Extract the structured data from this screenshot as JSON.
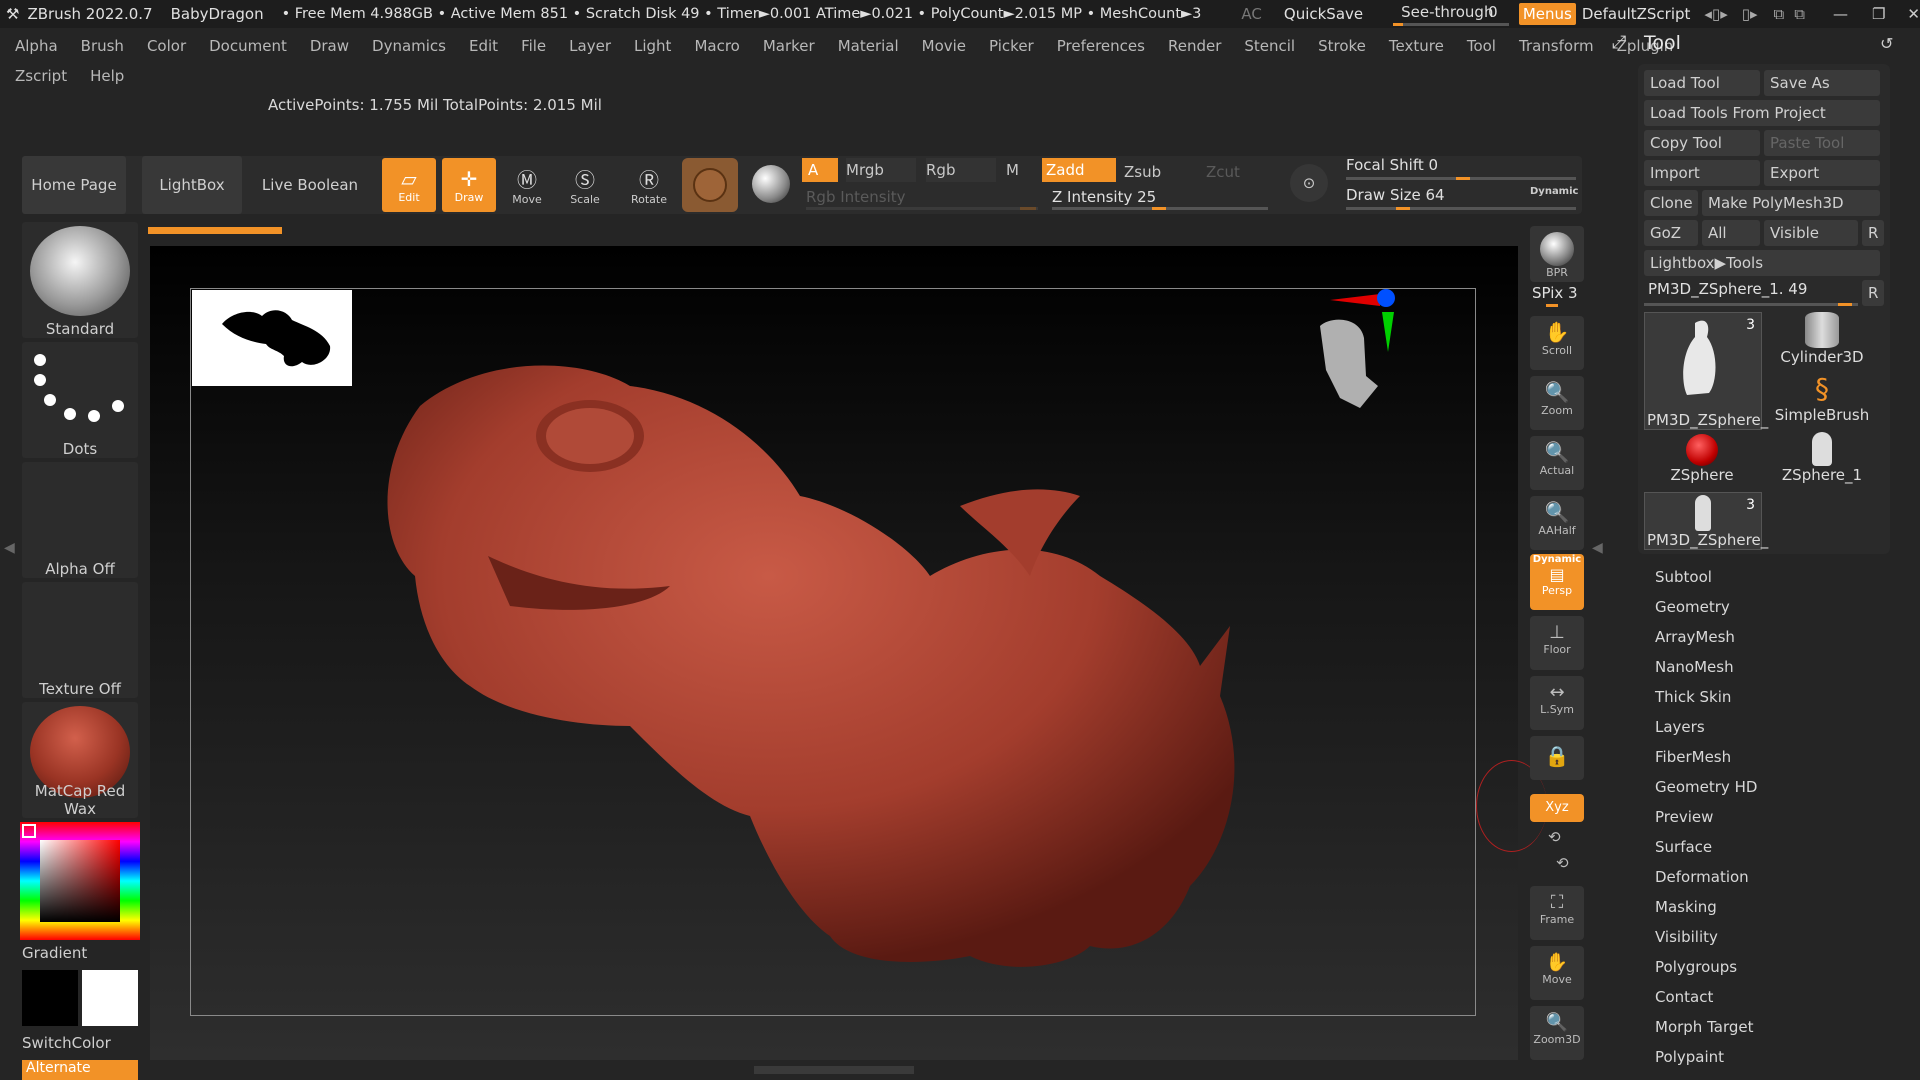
{
  "titlebar": {
    "app": "ZBrush 2022.0.7",
    "doc": "BabyDragon",
    "stats": "• Free Mem 4.988GB • Active Mem 851 • Scratch Disk 49 • Timer►0.001 ATime►0.021 • PolyCount►2.015 MP • MeshCount►3",
    "ac": "AC",
    "quicksave": "QuickSave",
    "seethrough": "See-through",
    "seethrough_val": "0",
    "menus": "Menus",
    "script": "DefaultZScript"
  },
  "menubar": {
    "row1": [
      "Alpha",
      "Brush",
      "Color",
      "Document",
      "Draw",
      "Dynamics",
      "Edit",
      "File",
      "Layer",
      "Light",
      "Macro",
      "Marker",
      "Material",
      "Movie",
      "Picker",
      "Preferences",
      "Render",
      "Stencil",
      "Stroke",
      "Texture",
      "Tool",
      "Transform",
      "Zplugin"
    ],
    "row2": [
      "Zscript",
      "Help"
    ]
  },
  "status": "ActivePoints: 1.755 Mil TotalPoints: 2.015 Mil",
  "toolbar": {
    "home": "Home Page",
    "lightbox": "LightBox",
    "liveboolean": "Live Boolean",
    "edit": "Edit",
    "draw": "Draw",
    "move": "Move",
    "scale": "Scale",
    "rotate": "Rotate",
    "a": "A",
    "mrgb": "Mrgb",
    "rgb": "Rgb",
    "m": "M",
    "zadd": "Zadd",
    "zsub": "Zsub",
    "zcut": "Zcut",
    "rgb_intensity": "Rgb Intensity",
    "z_intensity": "Z Intensity 25",
    "focal_shift": "Focal Shift 0",
    "draw_size": "Draw Size 64",
    "dynamic": "Dynamic"
  },
  "left": {
    "brush": "Standard",
    "stroke": "Dots",
    "alpha": "Alpha Off",
    "texture": "Texture Off",
    "material": "MatCap Red Wax",
    "gradient": "Gradient",
    "switchcolor": "SwitchColor",
    "alternate": "Alternate"
  },
  "shelf": {
    "bpr": "BPR",
    "spix": "SPix 3",
    "scroll": "Scroll",
    "zoom": "Zoom",
    "actual": "Actual",
    "aahalf": "AAHalf",
    "dynamic": "Dynamic",
    "persp": "Persp",
    "floor": "Floor",
    "lsym": "L.Sym",
    "xyz": "Xyz",
    "frame": "Frame",
    "move": "Move",
    "zoom3d": "Zoom3D"
  },
  "tool": {
    "title": "Tool",
    "load_tool": "Load Tool",
    "save_as": "Save As",
    "load_from_project": "Load Tools From Project",
    "copy_tool": "Copy Tool",
    "paste_tool": "Paste Tool",
    "import": "Import",
    "export": "Export",
    "clone": "Clone",
    "make_polymesh": "Make PolyMesh3D",
    "goz": "GoZ",
    "all": "All",
    "visible": "Visible",
    "r": "R",
    "lightbox_tools": "Lightbox▶Tools",
    "current_tool": "PM3D_ZSphere_1. 49",
    "thumbs": [
      {
        "label": "PM3D_ZSphere_",
        "badge": "3"
      },
      {
        "label": "Cylinder3D",
        "badge": ""
      },
      {
        "label": "SimpleBrush",
        "badge": ""
      },
      {
        "label": "ZSphere",
        "badge": ""
      },
      {
        "label": "ZSphere_1",
        "badge": ""
      },
      {
        "label": "PM3D_ZSphere_",
        "badge": "3"
      }
    ],
    "subpalettes": [
      "Subtool",
      "Geometry",
      "ArrayMesh",
      "NanoMesh",
      "Thick Skin",
      "Layers",
      "FiberMesh",
      "Geometry HD",
      "Preview",
      "Surface",
      "Deformation",
      "Masking",
      "Visibility",
      "Polygroups",
      "Contact",
      "Morph Target",
      "Polypaint"
    ]
  },
  "colors": {
    "accent": "#f29227",
    "bg": "#252525",
    "panel": "#2c2c2c",
    "model": "#b84a3a"
  }
}
